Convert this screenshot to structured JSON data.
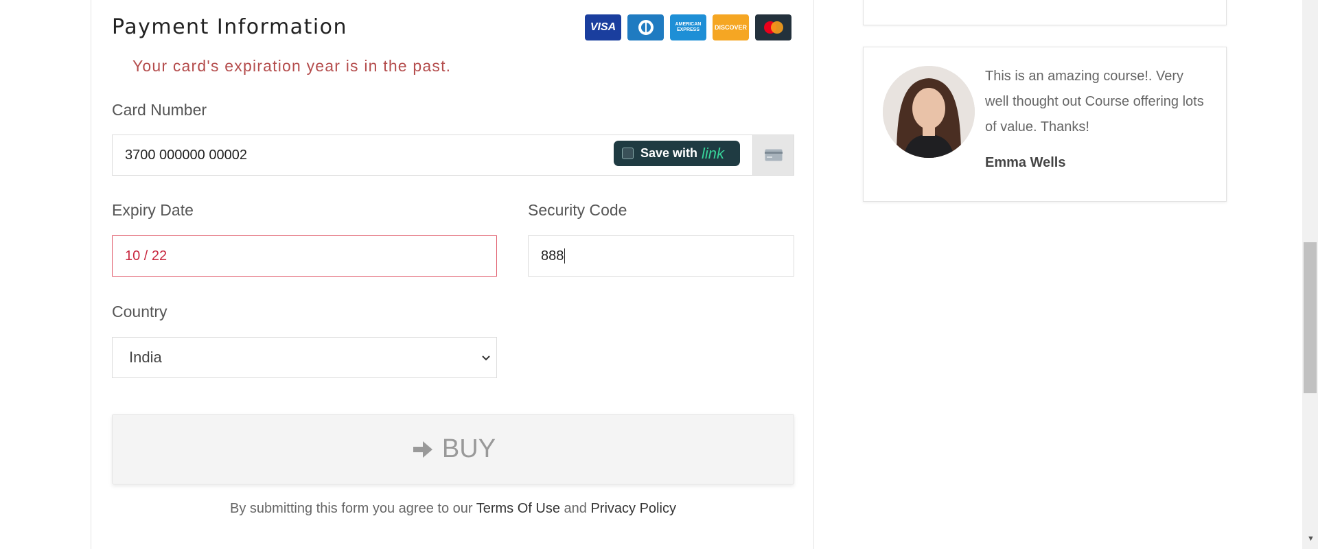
{
  "payment": {
    "title": "Payment Information",
    "error": "Your card's expiration year is in the past.",
    "card_logos": [
      {
        "name": "visa",
        "text": "VISA",
        "color": "#1a3e9e"
      },
      {
        "name": "diners",
        "text": "",
        "color": "#1f7bc1"
      },
      {
        "name": "amex",
        "text": "AMERICAN EXPRESS",
        "color": "#1e8fd6"
      },
      {
        "name": "discover",
        "text": "DISCOVER",
        "color": "#f5a623"
      },
      {
        "name": "mastercard",
        "text": "",
        "color": "#23313c"
      }
    ],
    "card_number_label": "Card Number",
    "card_number_value": "3700 000000 00002",
    "link_button": {
      "prefix": "Save with",
      "brand": "link"
    },
    "expiry_label": "Expiry Date",
    "expiry_value": "10 / 22",
    "security_label": "Security Code",
    "security_value": "888",
    "country_label": "Country",
    "country_value": "India",
    "buy_label": "BUY",
    "terms": {
      "prefix": "By submitting this form you agree to our ",
      "terms_link": "Terms Of Use",
      "middle": " and ",
      "privacy_link": "Privacy Policy"
    }
  },
  "testimonial": {
    "quote": "This is an amazing course!. Very well thought out Course offering lots of value. Thanks!",
    "author": "Emma Wells"
  }
}
